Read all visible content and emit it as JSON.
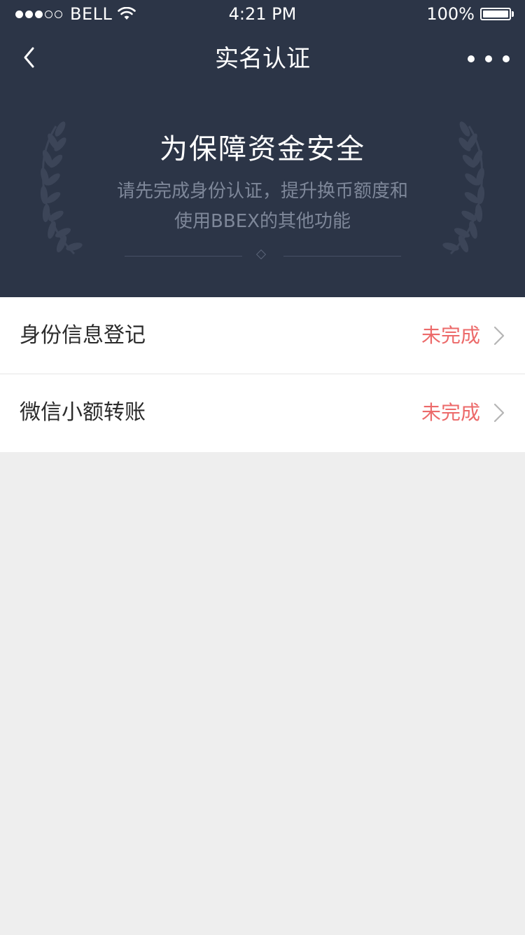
{
  "status_bar": {
    "signal_dots_filled": 3,
    "signal_dots_total": 5,
    "carrier": "BELL",
    "wifi_icon": "wifi-icon",
    "time": "4:21 PM",
    "battery_percent": "100%",
    "battery_level": 1.0
  },
  "nav": {
    "back_icon": "chevron-left-icon",
    "title": "实名认证",
    "more_icon": "more-dots-icon"
  },
  "banner": {
    "title": "为保障资金安全",
    "subtitle_line1": "请先完成身份认证，提升换币额度和",
    "subtitle_line2": "使用BBEX的其他功能",
    "decoration_icon": "laurel-wreath-icon"
  },
  "items": [
    {
      "label": "身份信息登记",
      "status": "未完成",
      "icon": "chevron-right-icon"
    },
    {
      "label": "微信小额转账",
      "status": "未完成",
      "icon": "chevron-right-icon"
    }
  ],
  "colors": {
    "header_bg": "#2c3547",
    "status_incomplete": "#ec6a6a",
    "page_bg": "#eeeeee",
    "subtitle": "#7e8799"
  }
}
